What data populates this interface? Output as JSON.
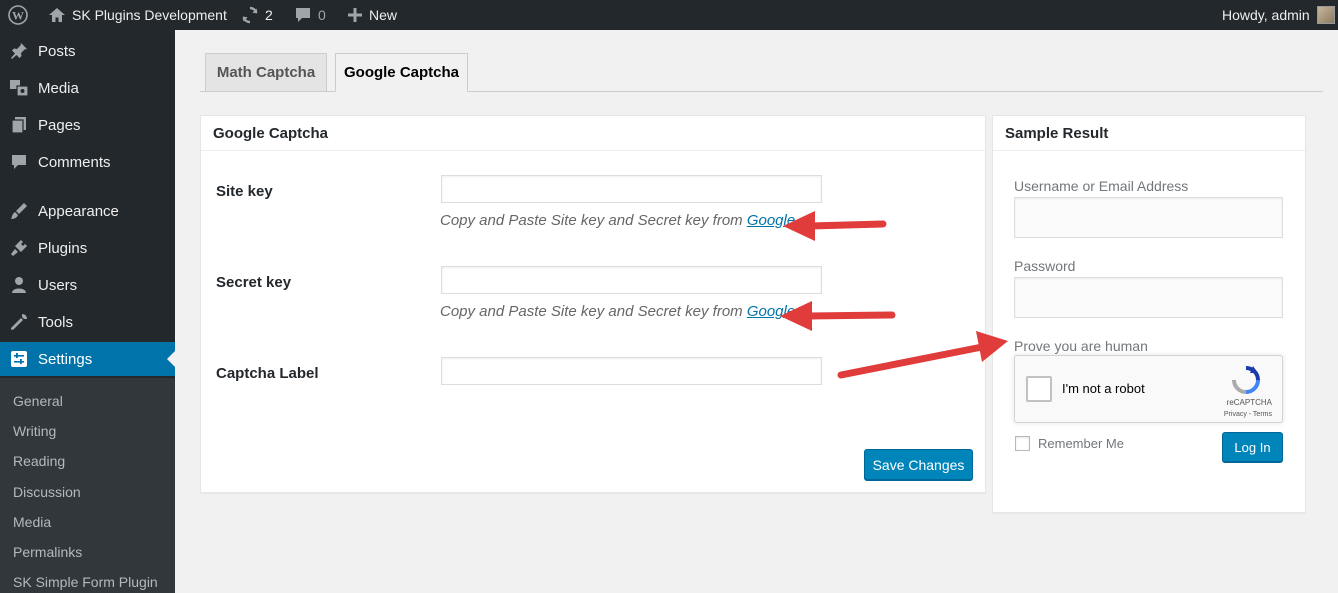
{
  "adminbar": {
    "site_name": "SK Plugins Development",
    "updates_count": "2",
    "comments_count": "0",
    "new_label": "New",
    "howdy": "Howdy, admin"
  },
  "sidebar": {
    "items": [
      {
        "label": "Posts",
        "icon": "pin-icon"
      },
      {
        "label": "Media",
        "icon": "media-icon"
      },
      {
        "label": "Pages",
        "icon": "pages-icon"
      },
      {
        "label": "Comments",
        "icon": "comments-icon"
      },
      {
        "label": "Appearance",
        "icon": "appearance-icon"
      },
      {
        "label": "Plugins",
        "icon": "plugins-icon"
      },
      {
        "label": "Users",
        "icon": "users-icon"
      },
      {
        "label": "Tools",
        "icon": "tools-icon"
      },
      {
        "label": "Settings",
        "icon": "settings-icon",
        "current": true
      }
    ],
    "submenu": [
      "General",
      "Writing",
      "Reading",
      "Discussion",
      "Media",
      "Permalinks",
      "SK Simple Form Plugin"
    ]
  },
  "tabs": [
    {
      "label": "Math Captcha",
      "active": false
    },
    {
      "label": "Google Captcha",
      "active": true
    }
  ],
  "settings_panel": {
    "title": "Google Captcha",
    "fields": [
      {
        "label": "Site key",
        "value": "",
        "description": "Copy and Paste Site key and Secret key from ",
        "link": "Google"
      },
      {
        "label": "Secret key",
        "value": "",
        "description": "Copy and Paste Site key and Secret key from ",
        "link": "Google"
      },
      {
        "label": "Captcha Label",
        "value": ""
      }
    ],
    "save_label": "Save Changes"
  },
  "sample_panel": {
    "title": "Sample Result",
    "username_label": "Username or Email Address",
    "password_label": "Password",
    "captcha_label": "Prove you are human",
    "recaptcha_text": "I'm not a robot",
    "recaptcha_brand": "reCAPTCHA",
    "recaptcha_terms": "Privacy - Terms",
    "remember_label": "Remember Me",
    "login_label": "Log In"
  },
  "colors": {
    "admin_bar": "#23282d",
    "accent": "#0073aa",
    "primary_button": "#0085ba",
    "annotation_arrow": "#e03c3c"
  }
}
